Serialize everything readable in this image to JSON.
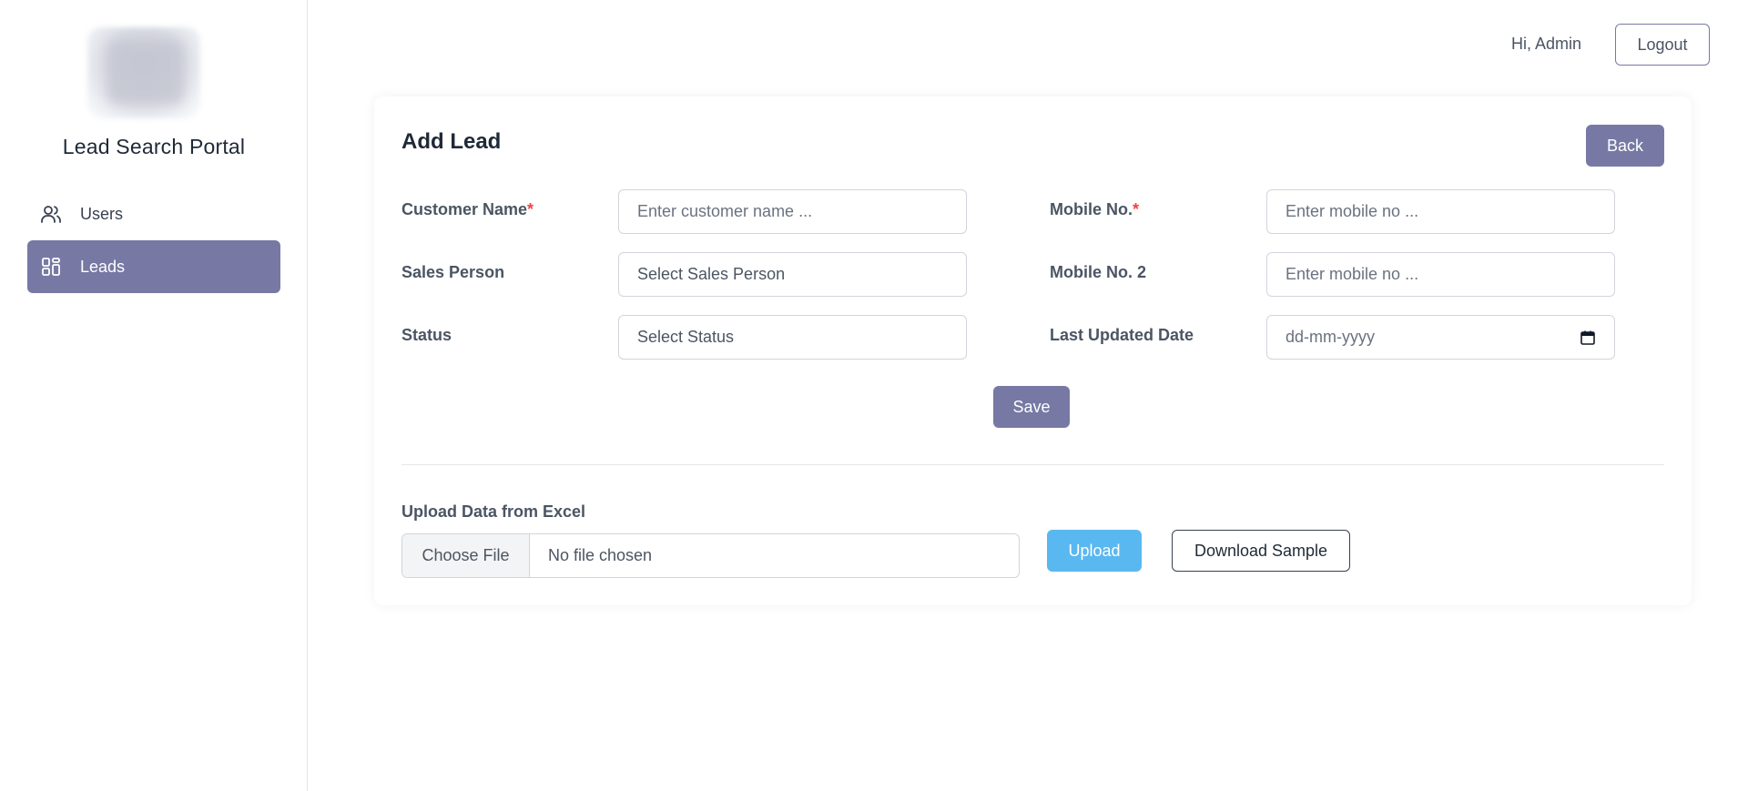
{
  "sidebar": {
    "brand": "Lead Search Portal",
    "items": [
      {
        "label": "Users",
        "icon": "users-icon",
        "active": false
      },
      {
        "label": "Leads",
        "icon": "dashboard-icon",
        "active": true
      }
    ]
  },
  "header": {
    "greeting": "Hi, Admin",
    "logout_label": "Logout"
  },
  "form": {
    "title": "Add Lead",
    "back_label": "Back",
    "customer_name": {
      "label": "Customer Name",
      "required_mark": "*",
      "placeholder": "Enter customer name ..."
    },
    "mobile_no": {
      "label": "Mobile No.",
      "required_mark": "*",
      "placeholder": "Enter mobile no ..."
    },
    "sales_person": {
      "label": "Sales Person",
      "value": "Select Sales Person"
    },
    "mobile_no_2": {
      "label": "Mobile No. 2",
      "placeholder": "Enter mobile no ..."
    },
    "status": {
      "label": "Status",
      "value": "Select Status"
    },
    "last_updated_date": {
      "label": "Last Updated Date",
      "placeholder": "dd-mm-yyyy"
    },
    "save_label": "Save"
  },
  "upload": {
    "label": "Upload Data from Excel",
    "choose_file_label": "Choose File",
    "file_status": "No file chosen",
    "upload_label": "Upload",
    "download_sample_label": "Download Sample"
  },
  "colors": {
    "accent": "#7779a4",
    "upload": "#5ab8f0",
    "required": "#ef4444"
  }
}
